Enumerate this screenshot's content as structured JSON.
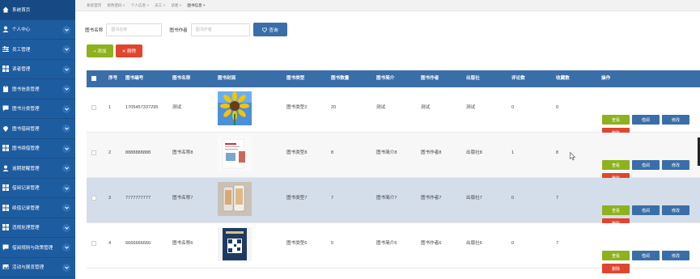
{
  "sidebar": {
    "items": [
      {
        "label": "系统首页",
        "icon": "home-icon",
        "chevron": false
      },
      {
        "label": "个人中心",
        "icon": "user-icon",
        "chevron": true
      },
      {
        "label": "员工管理",
        "icon": "sliders-icon",
        "chevron": true
      },
      {
        "label": "读者管理",
        "icon": "grid-icon",
        "chevron": true
      },
      {
        "label": "图书信息管理",
        "icon": "clipboard-icon",
        "chevron": true
      },
      {
        "label": "图书分类管理",
        "icon": "chat-icon",
        "chevron": true
      },
      {
        "label": "图书借阅管理",
        "icon": "pin-icon",
        "chevron": true
      },
      {
        "label": "图书续借管理",
        "icon": "grid-icon",
        "chevron": true
      },
      {
        "label": "逾期提醒管理",
        "icon": "person-icon",
        "chevron": true
      },
      {
        "label": "借阅记录管理",
        "icon": "grid-icon",
        "chevron": true
      },
      {
        "label": "续借记录管理",
        "icon": "grid-icon",
        "chevron": true
      },
      {
        "label": "违规处理管理",
        "icon": "grid-icon",
        "chevron": true
      },
      {
        "label": "借阅规则与政策管理",
        "icon": "chat-icon",
        "chevron": true
      },
      {
        "label": "活动与展览管理",
        "icon": "image-icon",
        "chevron": true
      },
      {
        "label": "...",
        "icon": "grid-icon",
        "chevron": true
      }
    ]
  },
  "tabs": [
    "系统首页",
    "修改密码 ×",
    "个人信息 ×",
    "员工 ×",
    "读者 ×",
    "图书信息 ×"
  ],
  "search": {
    "name_label": "图书名称",
    "name_placeholder": "图书名称",
    "author_label": "图书作者",
    "author_placeholder": "图书作者",
    "query_label": "查询"
  },
  "toolbar": {
    "add_label": "+ 添加",
    "delete_label": "✕ 删除"
  },
  "table": {
    "headers": [
      "序号",
      "图书编号",
      "图书名称",
      "图书封面",
      "图书类型",
      "图书数量",
      "图书简介",
      "图书作者",
      "出版社",
      "评论数",
      "收藏数",
      "操作"
    ],
    "rows": [
      {
        "index": "1",
        "code": "1705457337295",
        "name": "测试",
        "cover": "sunflower",
        "type": "图书类型2",
        "qty": "20",
        "intro": "测试",
        "author": "测试",
        "publisher": "测试",
        "comments": "0",
        "favs": "0"
      },
      {
        "index": "2",
        "code": "8888888888",
        "name": "图书名称8",
        "cover": "white-book",
        "type": "图书类型8",
        "qty": "8",
        "intro": "图书简介8",
        "author": "图书作者8",
        "publisher": "出版社8",
        "comments": "1",
        "favs": "8"
      },
      {
        "index": "3",
        "code": "7777777777",
        "name": "图书名称7",
        "cover": "phones",
        "type": "图书类型7",
        "qty": "7",
        "intro": "图书简介7",
        "author": "图书作者7",
        "publisher": "出版社7",
        "comments": "0",
        "favs": "7"
      },
      {
        "index": "4",
        "code": "6666666666",
        "name": "图书名称6",
        "cover": "qr-book",
        "type": "图书类型6",
        "qty": "5",
        "intro": "图书简介6",
        "author": "图书作者6",
        "publisher": "出版社6",
        "comments": "0",
        "favs": "7"
      }
    ],
    "actions": {
      "view": "查看",
      "borrow": "借阅",
      "edit": "修改",
      "delete": "删除"
    }
  },
  "colors": {
    "sidebar": "#1e5ca0",
    "primary": "#3a6ea8",
    "success": "#8db21d",
    "danger": "#e0452d",
    "highlight_row": "#d4deea"
  }
}
